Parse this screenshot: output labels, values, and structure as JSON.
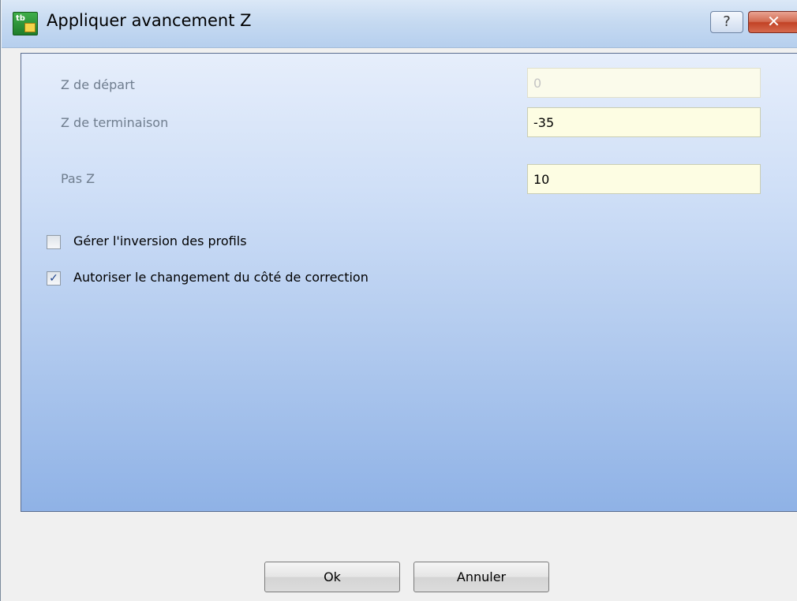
{
  "window": {
    "title": "Appliquer avancement Z",
    "app_icon_text": "tb",
    "help_glyph": "?",
    "close_glyph": "✕"
  },
  "form": {
    "z_start": {
      "label": "Z de départ",
      "value": "0",
      "enabled": false
    },
    "z_end": {
      "label": "Z de terminaison",
      "value": "-35",
      "enabled": true
    },
    "z_step": {
      "label": "Pas Z",
      "value": "10",
      "enabled": true
    },
    "manage_profile_inversion": {
      "label": "Gérer l'inversion des profils",
      "checked": false
    },
    "allow_correction_side_change": {
      "label": "Autoriser le changement du côté de correction",
      "checked": true,
      "check_glyph": "✓"
    }
  },
  "buttons": {
    "ok": "Ok",
    "cancel": "Annuler"
  },
  "colors": {
    "title_bar": "#c6daf1",
    "panel_top": "#e6eefb",
    "panel_bottom": "#8fb2e6",
    "input_background": "#fdfde3",
    "close_button": "#c24225"
  }
}
